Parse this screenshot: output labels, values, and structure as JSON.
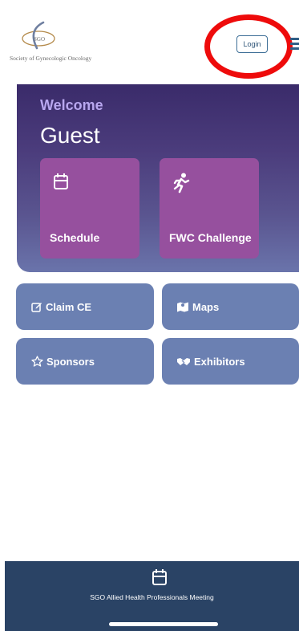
{
  "header": {
    "logo_text": "SGO",
    "logo_caption": "Society of Gynecologic Oncology",
    "login_label": "Login",
    "menu_icon": "hamburger-menu-icon",
    "highlight_color": "#ee0b0b"
  },
  "hero": {
    "welcome": "Welcome",
    "user": "Guest",
    "cards": [
      {
        "label": "Schedule",
        "icon": "calendar-icon"
      },
      {
        "label": "FWC Challenge",
        "icon": "runner-icon"
      }
    ]
  },
  "tiles": [
    {
      "label": "Claim CE",
      "icon": "edit-icon"
    },
    {
      "label": "Maps",
      "icon": "map-icon"
    },
    {
      "label": "Sponsors",
      "icon": "star-icon"
    },
    {
      "label": "Exhibitors",
      "icon": "handshake-icon"
    }
  ],
  "bottom_bar": {
    "label": "SGO Allied Health Professionals Meeting",
    "icon": "calendar-icon"
  },
  "colors": {
    "hero_top": "#3a2b6a",
    "hero_bottom": "#6a74ab",
    "card": "#96509e",
    "tile": "#6b80b2",
    "bottom_bar": "#2a4365",
    "welcome": "#b8a7ef"
  }
}
